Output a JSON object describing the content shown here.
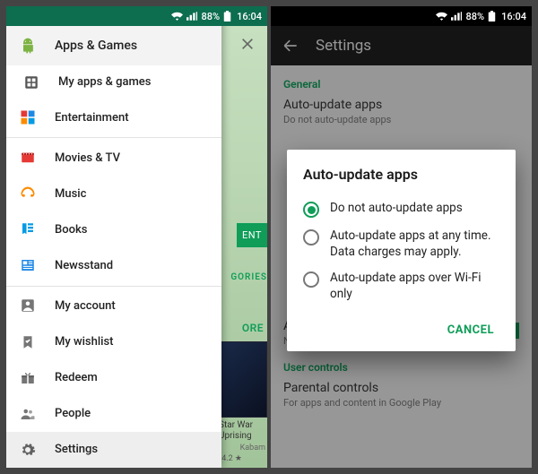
{
  "status": {
    "battery": "88%",
    "time": "16:04"
  },
  "left": {
    "drawer": {
      "header_label": "Apps & Games",
      "subitem_label": "My apps & games",
      "items": [
        {
          "label": "Entertainment"
        },
        {
          "label": "Movies & TV"
        },
        {
          "label": "Music"
        },
        {
          "label": "Books"
        },
        {
          "label": "Newsstand"
        },
        {
          "label": "My account"
        },
        {
          "label": "My wishlist"
        },
        {
          "label": "Redeem"
        },
        {
          "label": "People"
        },
        {
          "label": "Settings"
        }
      ]
    },
    "under": {
      "chip_green": "ENT",
      "chip_categories": "GORIES",
      "more": "ORE",
      "app_title_line1": "Star War",
      "app_title_line2": "Uprising",
      "app_publisher": "Kabam",
      "app_rating": "4.2 ★"
    }
  },
  "right": {
    "appbar_title": "Settings",
    "sections": {
      "general_label": "General",
      "auto_update_title": "Auto-update apps",
      "auto_update_sub": "Do not auto-update apps",
      "auto_updated_title": "Apps were auto-updated",
      "auto_updated_sub": "Notify when apps are automatically updated",
      "user_controls_label": "User controls",
      "parental_title": "Parental controls",
      "parental_sub": "For apps and content in Google Play"
    },
    "dialog": {
      "title": "Auto-update apps",
      "options": [
        "Do not auto-update apps",
        "Auto-update apps at any time. Data charges may apply.",
        "Auto-update apps over Wi-Fi only"
      ],
      "cancel": "CANCEL"
    }
  }
}
